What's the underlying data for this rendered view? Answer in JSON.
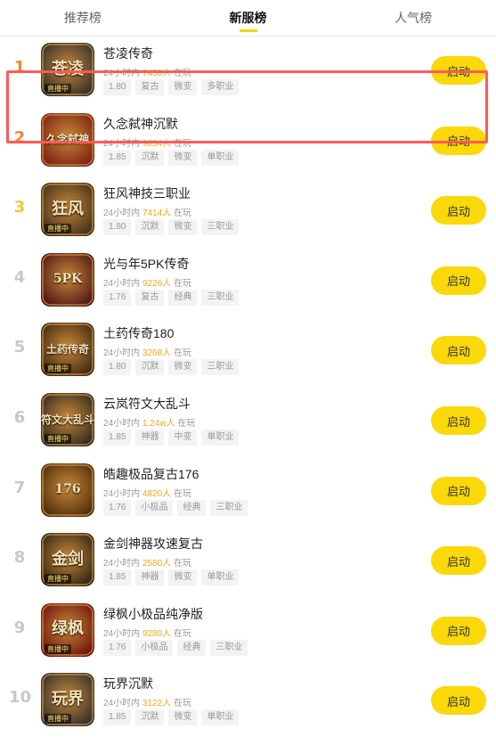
{
  "tabs": [
    {
      "label": "推荐榜",
      "active": false
    },
    {
      "label": "新服榜",
      "active": true
    },
    {
      "label": "人气榜",
      "active": false
    }
  ],
  "stat_prefix": "24小时内",
  "stat_suffix": "在玩",
  "button_label": "启动",
  "items": [
    {
      "rank": "1",
      "title": "苍凌传奇",
      "players": "7450人",
      "tags": [
        "1.80",
        "复古",
        "微变",
        "多职业"
      ],
      "icon_text": "苍凌",
      "icon_badge": "直播中",
      "icon_color": "#2a2a2a"
    },
    {
      "rank": "2",
      "title": "久念弑神沉默",
      "players": "9054人",
      "tags": [
        "1.85",
        "沉默",
        "微变",
        "单职业"
      ],
      "icon_text": "久念弑神",
      "icon_badge": "",
      "icon_color": "#7a1c10"
    },
    {
      "rank": "3",
      "title": "狂风神技三职业",
      "players": "7414人",
      "tags": [
        "1.80",
        "沉默",
        "微变",
        "三职业"
      ],
      "icon_text": "狂风",
      "icon_badge": "直播中",
      "icon_color": "#3b2a18"
    },
    {
      "rank": "4",
      "title": "光与年5PK传奇",
      "players": "9226人",
      "tags": [
        "1.76",
        "复古",
        "经典",
        "三职业"
      ],
      "icon_text": "5PK",
      "icon_badge": "",
      "icon_color": "#4a1014"
    },
    {
      "rank": "5",
      "title": "土药传奇180",
      "players": "3268人",
      "tags": [
        "1.80",
        "沉默",
        "微变",
        "三职业"
      ],
      "icon_text": "土药传奇",
      "icon_badge": "直播中",
      "icon_color": "#3a2410"
    },
    {
      "rank": "6",
      "title": "云岚符文大乱斗",
      "players": "1.24w人",
      "tags": [
        "1.85",
        "神器",
        "中变",
        "单职业"
      ],
      "icon_text": "符文大乱斗",
      "icon_badge": "直播中",
      "icon_color": "#2b2420"
    },
    {
      "rank": "7",
      "title": "皓趣极品复古176",
      "players": "4820人",
      "tags": [
        "1.76",
        "小极品",
        "经典",
        "三职业"
      ],
      "icon_text": "176",
      "icon_badge": "",
      "icon_color": "#4a2808"
    },
    {
      "rank": "8",
      "title": "金剑神器攻速复古",
      "players": "2580人",
      "tags": [
        "1.85",
        "神器",
        "微变",
        "单职业"
      ],
      "icon_text": "金剑",
      "icon_badge": "直播中",
      "icon_color": "#2a2012"
    },
    {
      "rank": "9",
      "title": "绿枫小极品纯净版",
      "players": "9280人",
      "tags": [
        "1.76",
        "小极品",
        "经典",
        "三职业"
      ],
      "icon_text": "绿枫",
      "icon_badge": "直播中",
      "icon_color": "#6a0c0c"
    },
    {
      "rank": "10",
      "title": "玩界沉默",
      "players": "3122人",
      "tags": [
        "1.85",
        "沉默",
        "微变",
        "单职业"
      ],
      "icon_text": "玩界",
      "icon_badge": "直播中",
      "icon_color": "#2a2a2a"
    }
  ]
}
